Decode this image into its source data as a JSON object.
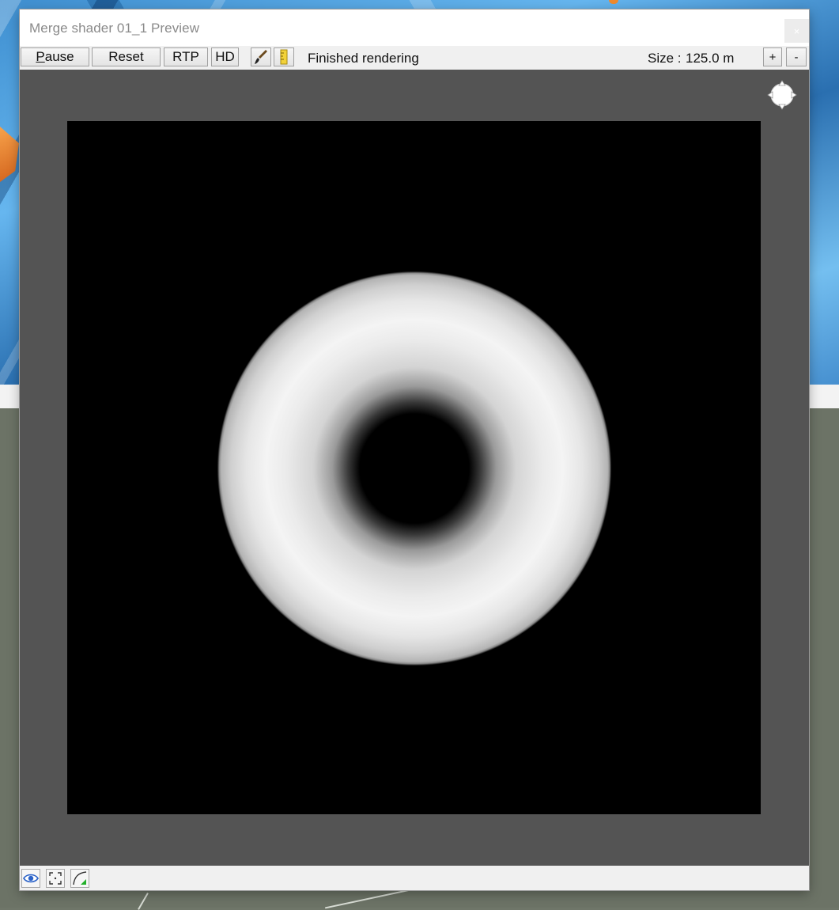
{
  "window": {
    "title": "Merge shader 01_1 Preview",
    "close_label": "×"
  },
  "toolbar": {
    "pause_label_underlined": "P",
    "pause_label_rest": "ause",
    "reset_label": "Reset",
    "rtp_label": "RTP",
    "hd_label": "HD",
    "status_text": "Finished rendering",
    "size_label": "Size :",
    "size_value": "125.0 m",
    "plus_label": "+",
    "minus_label": "-"
  },
  "icons": {
    "brush": "brush-icon",
    "ruler": "ruler-icon",
    "navigate": "navigate-icon",
    "eye": "eye-icon",
    "frame": "frame-icon",
    "curve": "curve-icon"
  },
  "colors": {
    "viewport_bg": "#545454",
    "render_bg": "#000000",
    "accent_green": "#22b02a",
    "eye_blue": "#2a62c8"
  }
}
